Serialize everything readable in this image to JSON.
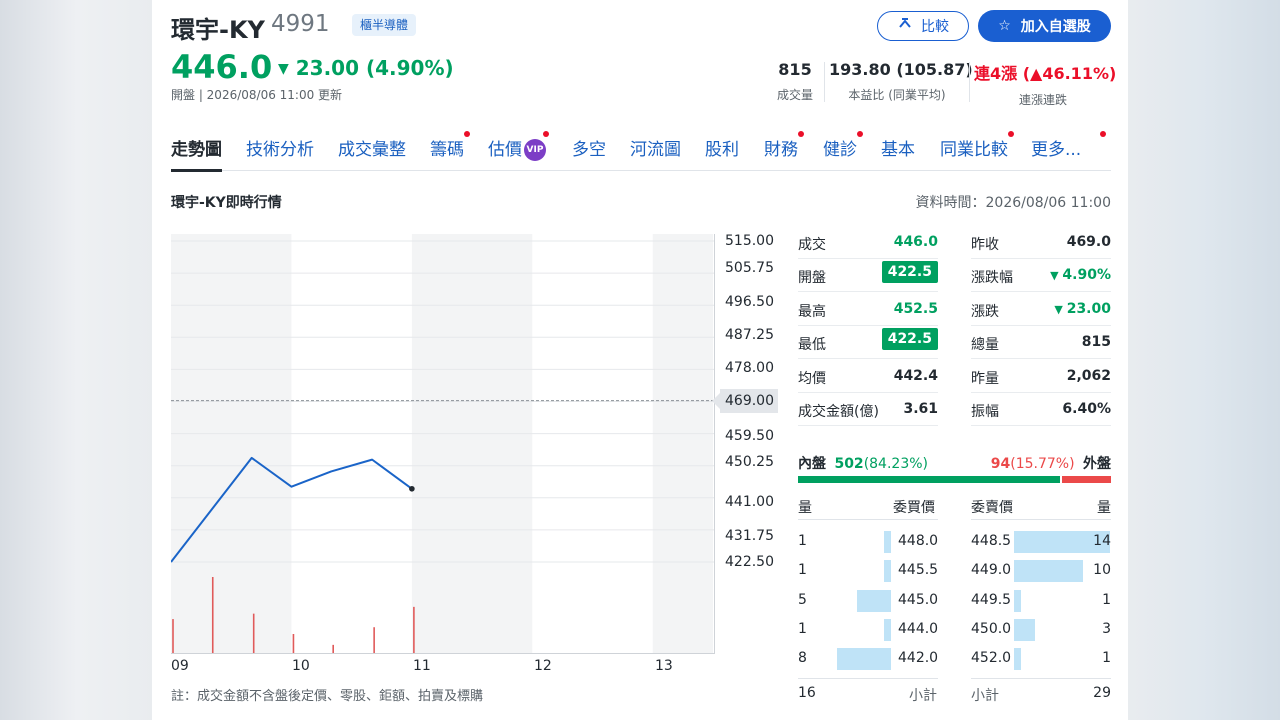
{
  "header": {
    "name": "環宇-KY",
    "code": "4991",
    "badge": "櫃半導體",
    "price": "446.0",
    "change": "23.00 (4.90%)",
    "update": "開盤 | 2026/08/06 11:00 更新",
    "compare_label": "比較",
    "add_label": "加入自選股"
  },
  "stats": [
    {
      "value": "815",
      "label": "成交量"
    },
    {
      "value": "193.80 (105.87)",
      "label": "本益比 (同業平均)"
    },
    {
      "value_prefix": "連4漲",
      "value_suffix": "(▲46.11%)",
      "label": "連漲連跌"
    }
  ],
  "tabs": [
    {
      "label": "走勢圖",
      "active": true,
      "dot": false,
      "vip": false
    },
    {
      "label": "技術分析",
      "dot": false
    },
    {
      "label": "成交彙整",
      "dot": false
    },
    {
      "label": "籌碼",
      "dot": true
    },
    {
      "label": "估價",
      "dot": true,
      "vip": true
    },
    {
      "label": "多空",
      "dot": false
    },
    {
      "label": "河流圖",
      "dot": false
    },
    {
      "label": "股利",
      "dot": false
    },
    {
      "label": "財務",
      "dot": true
    },
    {
      "label": "健診",
      "dot": true
    },
    {
      "label": "基本",
      "dot": false
    },
    {
      "label": "同業比較",
      "dot": true
    },
    {
      "label": "更多...",
      "dot": true
    }
  ],
  "vip_label": "VIP",
  "section": {
    "title": "環宇-KY即時行情",
    "data_time": "資料時間：2026/08/06 11:00"
  },
  "chart_data": {
    "type": "line",
    "x_ticks": [
      "09",
      "10",
      "11",
      "12",
      "13"
    ],
    "y_ticks": [
      "515.00",
      "505.75",
      "496.50",
      "487.25",
      "478.00",
      "469.00",
      "459.50",
      "450.25",
      "441.00",
      "431.75",
      "422.50"
    ],
    "ylim": [
      422.5,
      515.0
    ],
    "reference_price": 469.0,
    "reference_label": "469.00",
    "price_series": {
      "time": [
        9.0,
        9.67,
        10.0,
        10.33,
        10.67,
        11.0
      ],
      "price": [
        422.5,
        452.5,
        444.2,
        448.6,
        452.0,
        443.6
      ]
    },
    "volume_series": {
      "time": [
        9.0,
        9.33,
        9.67,
        10.0,
        10.33,
        10.67,
        11.0
      ],
      "volume": [
        250,
        560,
        290,
        140,
        60,
        190,
        340
      ],
      "max": 560
    }
  },
  "quote": {
    "left": [
      {
        "label": "成交",
        "value": "446.0",
        "style": "green"
      },
      {
        "label": "開盤",
        "value": "422.5",
        "style": "gbox"
      },
      {
        "label": "最高",
        "value": "452.5",
        "style": "green"
      },
      {
        "label": "最低",
        "value": "422.5",
        "style": "gbox"
      },
      {
        "label": "均價",
        "value": "442.4",
        "style": "plain"
      },
      {
        "label": "成交金額(億)",
        "value": "3.61",
        "style": "plain"
      }
    ],
    "right": [
      {
        "label": "昨收",
        "value": "469.0",
        "style": "plain"
      },
      {
        "label": "漲跌幅",
        "value": "4.90%",
        "style": "green-down"
      },
      {
        "label": "漲跌",
        "value": "23.00",
        "style": "green-down"
      },
      {
        "label": "總量",
        "value": "815",
        "style": "plain"
      },
      {
        "label": "昨量",
        "value": "2,062",
        "style": "plain"
      },
      {
        "label": "振幅",
        "value": "6.40%",
        "style": "plain"
      }
    ]
  },
  "ratio": {
    "inner_label": "內盤",
    "inner_value": "502",
    "inner_pct": "(84.23%)",
    "outer_value": "94",
    "outer_pct": "(15.77%)",
    "outer_label": "外盤",
    "inner_fraction": 0.8423,
    "inner_color": "#00a060",
    "outer_color": "#eb4949"
  },
  "orderbook": {
    "headers": {
      "qty": "量",
      "bid": "委買價",
      "ask": "委賣價",
      "qty2": "量"
    },
    "rows": [
      {
        "bid_qty": "1",
        "bid": "448.0",
        "ask": "448.5",
        "ask_qty": "14"
      },
      {
        "bid_qty": "1",
        "bid": "445.5",
        "ask": "449.0",
        "ask_qty": "10"
      },
      {
        "bid_qty": "5",
        "bid": "445.0",
        "ask": "449.5",
        "ask_qty": "1"
      },
      {
        "bid_qty": "1",
        "bid": "444.0",
        "ask": "450.0",
        "ask_qty": "3"
      },
      {
        "bid_qty": "8",
        "bid": "442.0",
        "ask": "452.0",
        "ask_qty": "1"
      }
    ],
    "bid_levels": [
      1,
      1,
      5,
      1,
      8
    ],
    "ask_levels": [
      14,
      10,
      1,
      3,
      1
    ],
    "bid_total": "16",
    "ask_total": "29",
    "subtotal_label": "小計"
  },
  "footnote": "註：成交金額不含盤後定價、零股、鉅額、拍賣及標購",
  "colors": {
    "up": "#eb0f29",
    "down": "#00a060",
    "accent": "#1a5fd1",
    "line": "#1a64c8"
  }
}
